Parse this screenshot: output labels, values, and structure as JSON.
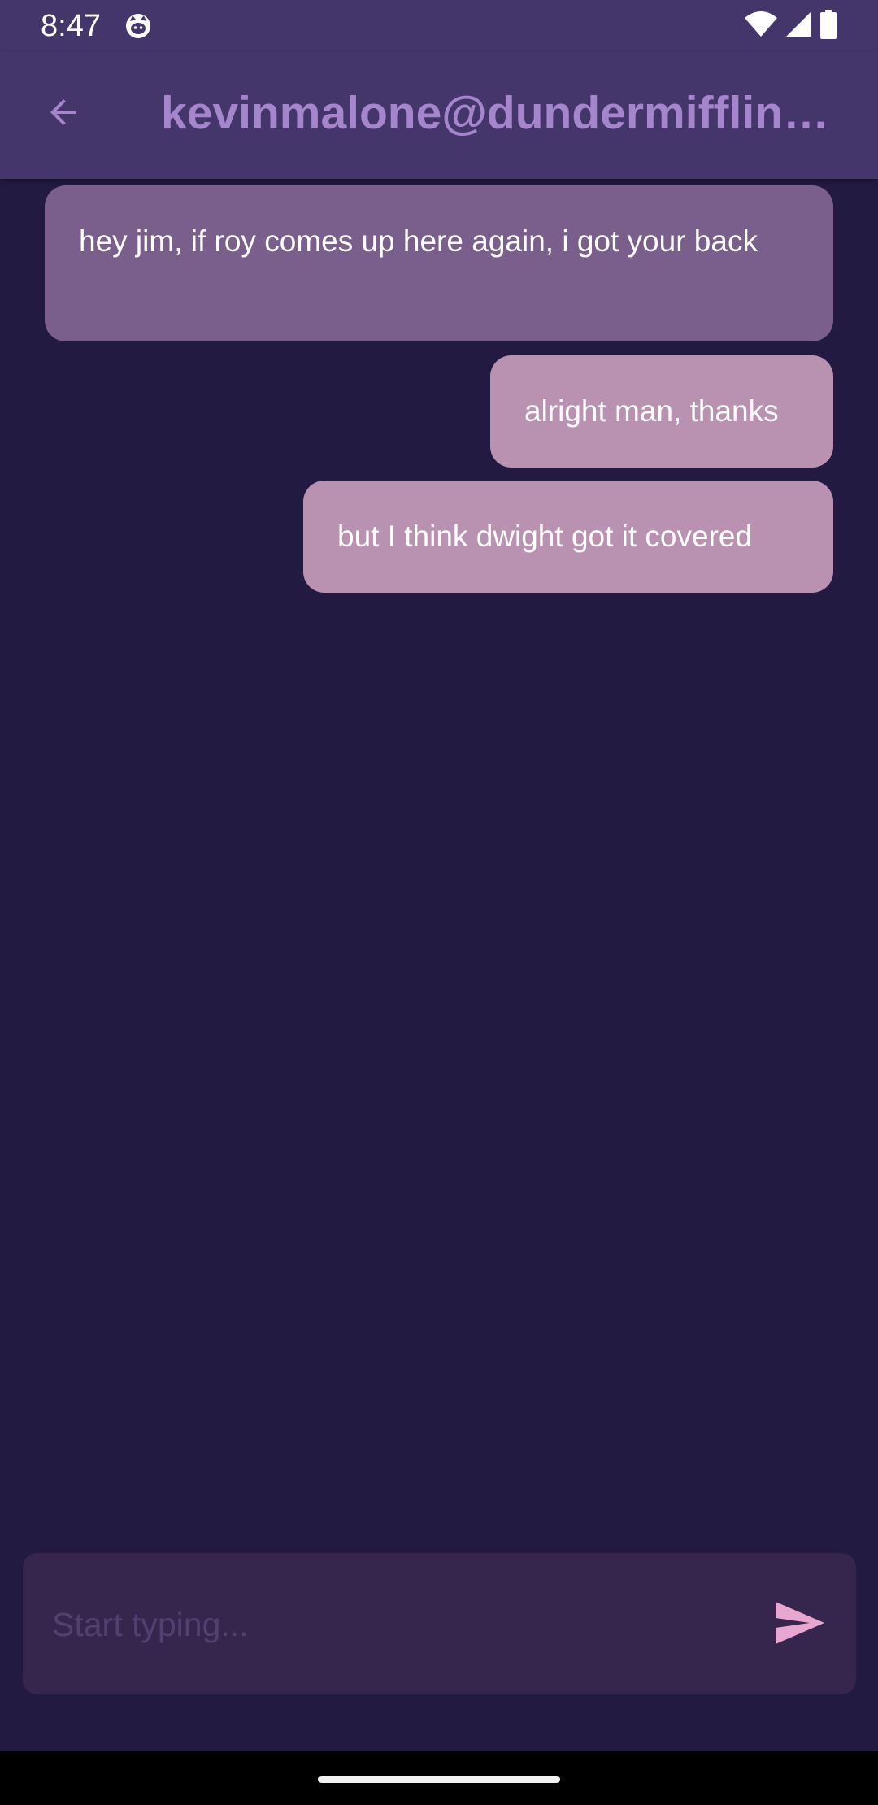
{
  "status_bar": {
    "time": "8:47",
    "icons": [
      "cat-notification-icon",
      "wifi-icon",
      "cell-signal-icon",
      "battery-icon"
    ]
  },
  "app_bar": {
    "back_icon": "arrow-back-icon",
    "title": "kevinmalone@dundermifflin.com"
  },
  "messages": [
    {
      "direction": "incoming",
      "text": "hey jim, if roy comes up here again, i got your back"
    },
    {
      "direction": "outgoing",
      "text": "alright man, thanks"
    },
    {
      "direction": "outgoing",
      "text": "but I think dwight got it covered"
    }
  ],
  "composer": {
    "placeholder": "Start typing...",
    "value": "",
    "send_icon": "send-icon"
  },
  "colors": {
    "background": "#231a42",
    "app_bar": "#44366b",
    "title": "#a585cc",
    "incoming_bubble": "#7a5e8b",
    "outgoing_bubble": "#b892b0",
    "composer": "#36264e",
    "send_icon": "#e8a7d0"
  }
}
